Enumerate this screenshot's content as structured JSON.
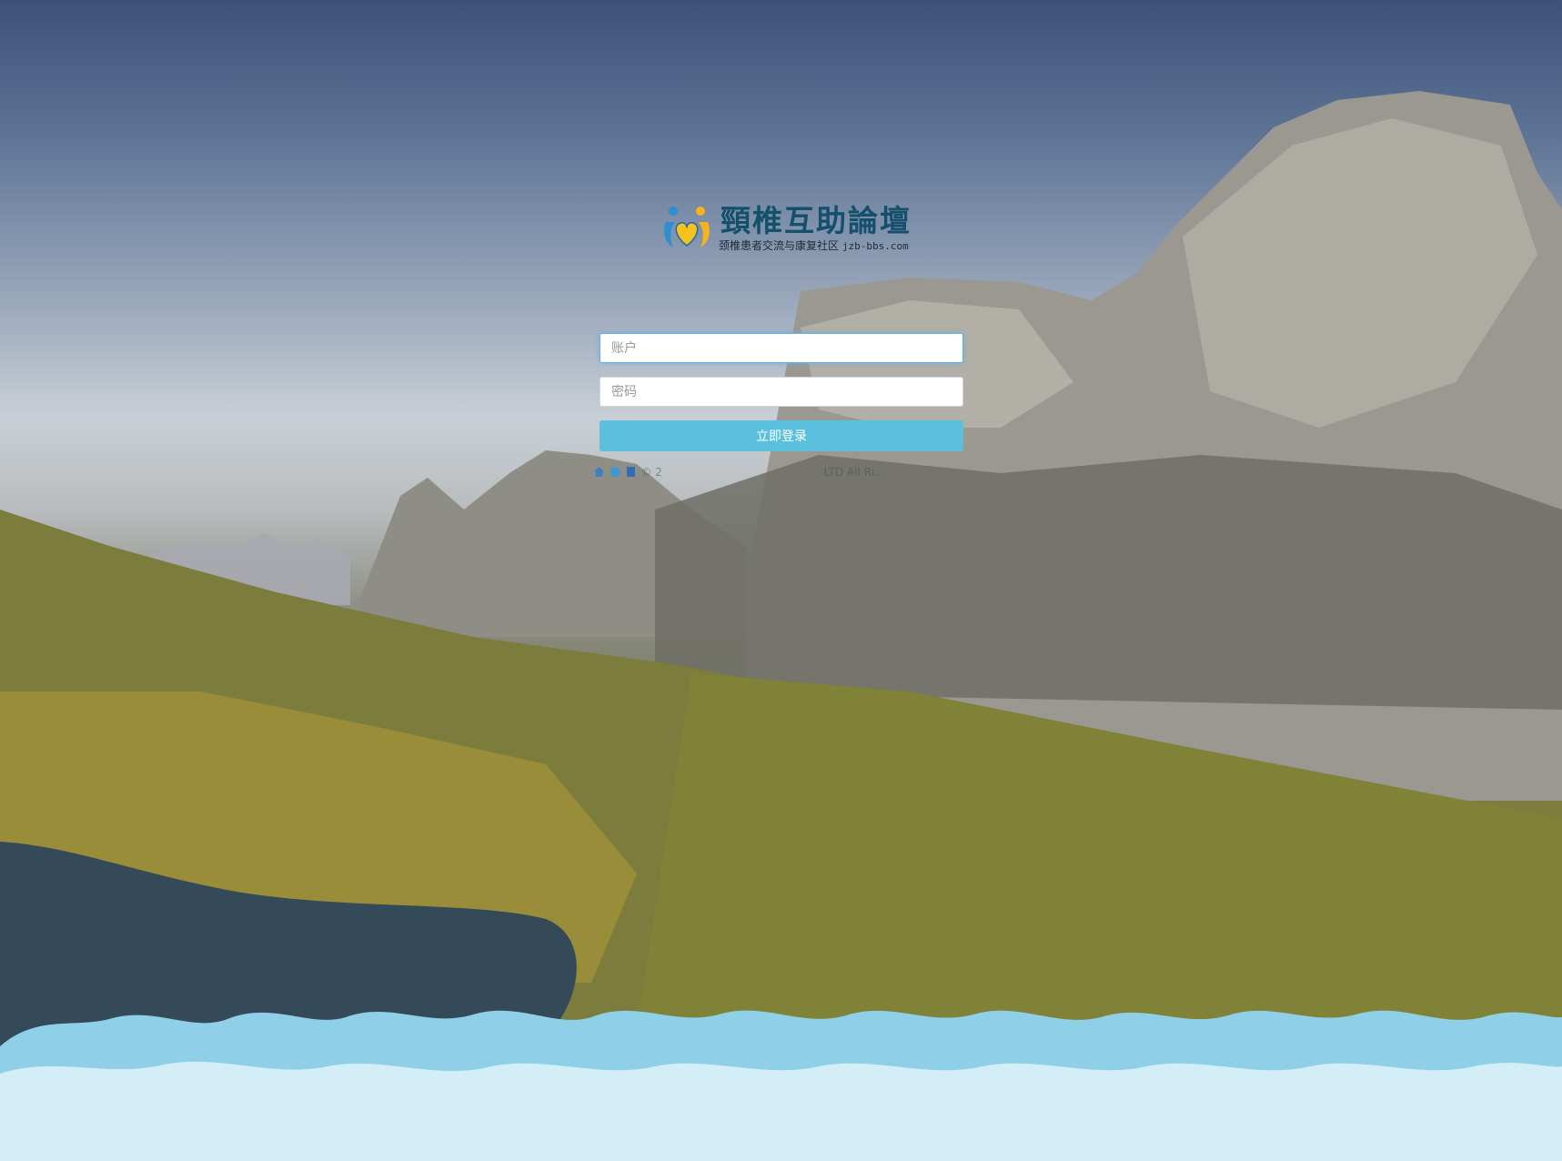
{
  "logo": {
    "title": "頸椎互助論壇",
    "subtitle": "颈椎患者交流与康复社区",
    "domain": "jzb-bbs.com",
    "icon": "two-people-heart-logo"
  },
  "login": {
    "account_placeholder": "账户",
    "password_placeholder": "密码",
    "submit_label": "立即登录"
  },
  "footer": {
    "icons": [
      "home-icon",
      "globe-icon",
      "book-icon"
    ],
    "copyright_prefix": "© 2",
    "copyright_suffix": "LTD All Ri..."
  },
  "colors": {
    "button": "#5bc0de",
    "logo_title": "#14506c",
    "focus_border": "#66afe9"
  }
}
